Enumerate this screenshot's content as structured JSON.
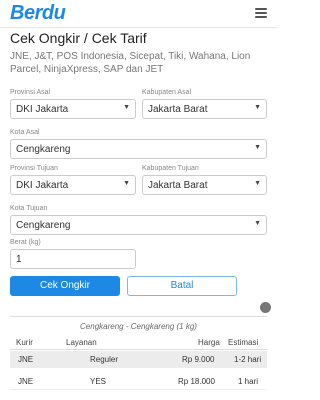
{
  "header": {
    "logo": "Berdu"
  },
  "page": {
    "title": "Cek Ongkir / Cek Tarif",
    "subtitle": "JNE, J&T, POS Indonesia, Sicepat, Tiki, Wahana, Lion Parcel, NinjaXpress, SAP dan JET"
  },
  "form": {
    "provinsi_asal": {
      "label": "Provinsi Asal",
      "value": "DKI Jakarta"
    },
    "kabupaten_asal": {
      "label": "Kabupaten Asal",
      "value": "Jakarta Barat"
    },
    "kota_asal": {
      "label": "Kota Asal",
      "value": "Cengkareng"
    },
    "provinsi_tujuan": {
      "label": "Provinsi Tujuan",
      "value": "DKI Jakarta"
    },
    "kabupaten_tujuan": {
      "label": "Kabupaten Tujuan",
      "value": "Jakarta Barat"
    },
    "kota_tujuan": {
      "label": "Kota Tujuan",
      "value": "Cengkareng"
    },
    "berat": {
      "label": "Berat (kg)",
      "value": "1"
    }
  },
  "buttons": {
    "cek": "Cek Ongkir",
    "batal": "Batal"
  },
  "results": {
    "route": "Cengkareng - Cengkareng (1 kg)",
    "headers": {
      "kurir": "Kurir",
      "layanan": "Layanan",
      "harga": "Harga",
      "estimasi": "Estimasi"
    },
    "rows": [
      {
        "kurir": "JNE",
        "layanan": "Reguler",
        "harga": "Rp 9.000",
        "estimasi": "1-2 hari"
      },
      {
        "kurir": "JNE",
        "layanan": "YES",
        "harga": "Rp 18.000",
        "estimasi": "1 hari"
      }
    ]
  }
}
